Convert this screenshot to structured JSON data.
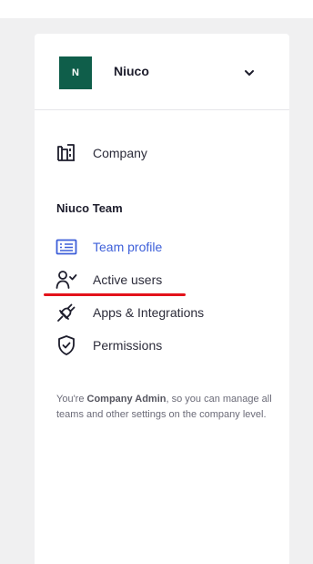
{
  "organization": {
    "avatar_initial": "N",
    "name": "Niuco",
    "avatar_color": "#0f5e4a"
  },
  "nav": {
    "company": {
      "label": "Company",
      "icon": "building-icon"
    },
    "section_title": "Niuco Team",
    "items": [
      {
        "label": "Team profile",
        "icon": "id-card-icon",
        "active": true
      },
      {
        "label": "Active users",
        "icon": "user-check-icon",
        "active": false
      },
      {
        "label": "Apps & Integrations",
        "icon": "plug-icon",
        "active": false
      },
      {
        "label": "Permissions",
        "icon": "shield-check-icon",
        "active": false
      }
    ]
  },
  "footer": {
    "prefix": "You're ",
    "role": "Company Admin",
    "suffix": ", so you can manage all teams and other settings on the company level."
  },
  "colors": {
    "accent": "#3d5fd9",
    "annotation": "#e3121a",
    "background": "#f0f0f1"
  }
}
